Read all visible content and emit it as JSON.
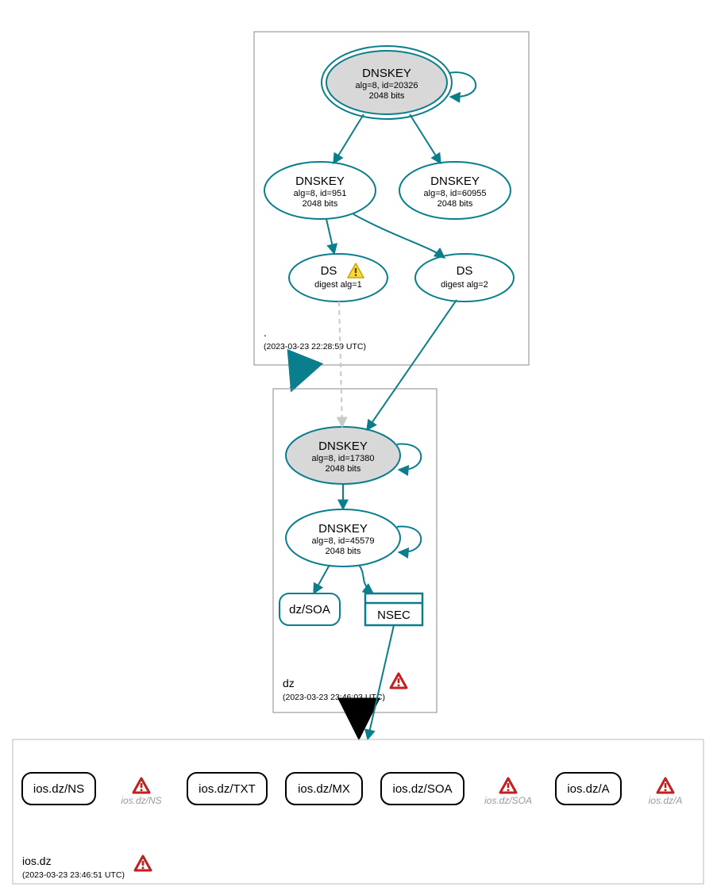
{
  "zones": {
    "root": {
      "label": ".",
      "timestamp": "(2023-03-23 22:28:59 UTC)"
    },
    "dz": {
      "label": "dz",
      "timestamp": "(2023-03-23 23:46:03 UTC)"
    },
    "iosdz": {
      "label": "ios.dz",
      "timestamp": "(2023-03-23 23:46:51 UTC)"
    }
  },
  "nodes": {
    "root_ksk": {
      "title": "DNSKEY",
      "line2": "alg=8, id=20326",
      "line3": "2048 bits"
    },
    "root_zsk1": {
      "title": "DNSKEY",
      "line2": "alg=8, id=951",
      "line3": "2048 bits"
    },
    "root_zsk2": {
      "title": "DNSKEY",
      "line2": "alg=8, id=60955",
      "line3": "2048 bits"
    },
    "ds1": {
      "title": "DS",
      "line2": "digest alg=1"
    },
    "ds2": {
      "title": "DS",
      "line2": "digest alg=2"
    },
    "dz_ksk": {
      "title": "DNSKEY",
      "line2": "alg=8, id=17380",
      "line3": "2048 bits"
    },
    "dz_zsk": {
      "title": "DNSKEY",
      "line2": "alg=8, id=45579",
      "line3": "2048 bits"
    },
    "dz_soa": {
      "title": "dz/SOA"
    },
    "nsec": {
      "title": "NSEC"
    },
    "ios_ns": {
      "title": "ios.dz/NS"
    },
    "ios_txt": {
      "title": "ios.dz/TXT"
    },
    "ios_mx": {
      "title": "ios.dz/MX"
    },
    "ios_soa": {
      "title": "ios.dz/SOA"
    },
    "ios_a": {
      "title": "ios.dz/A"
    }
  },
  "ghosts": {
    "g_ns": "ios.dz/NS",
    "g_soa": "ios.dz/SOA",
    "g_a": "ios.dz/A"
  }
}
